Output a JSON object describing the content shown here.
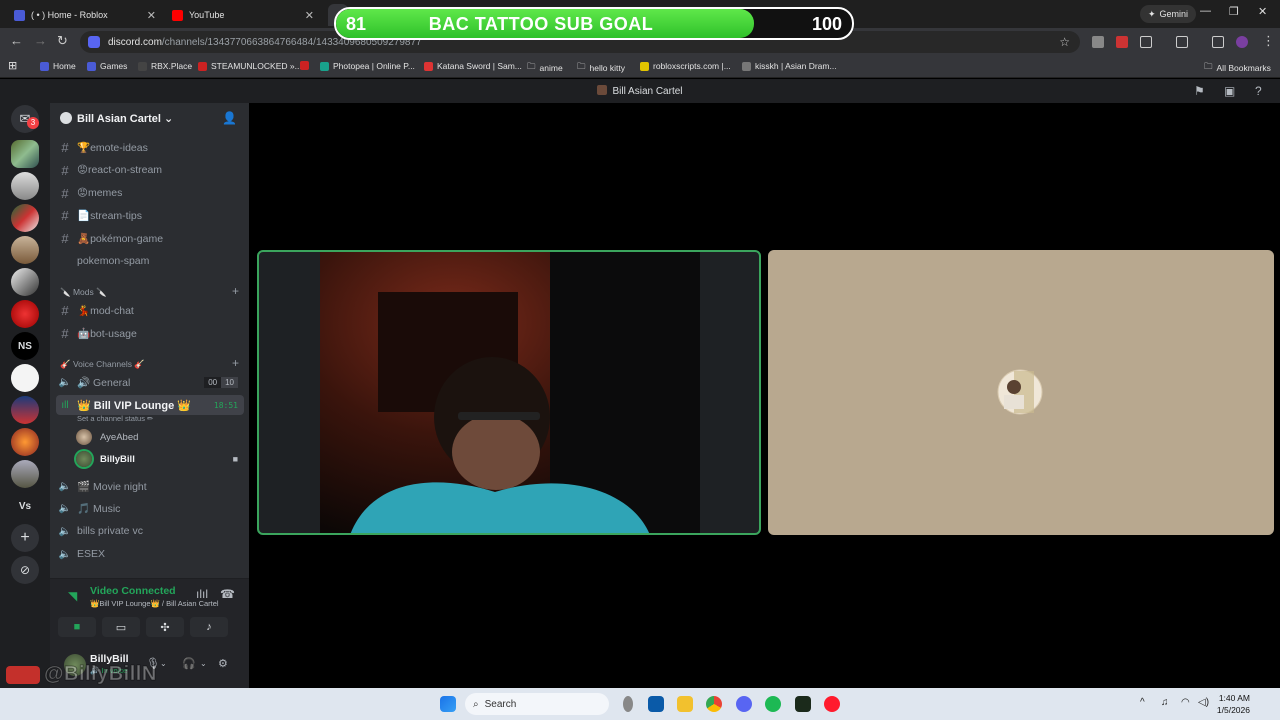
{
  "browser": {
    "tabs": [
      {
        "title": "( • ) Home - Roblox"
      },
      {
        "title": "YouTube"
      }
    ],
    "gemini_label": "Gemini",
    "url_host": "discord.com",
    "url_path": "/channels/1343770663864766484/1433409680509279877",
    "bookmarks": [
      "Home",
      "Games",
      "RBX.Place",
      "STEAMUNLOCKED »...",
      "Photopea | Online P...",
      "Katana Sword | Sam...",
      "anime",
      "hello kitty",
      "robloxscripts.com |...",
      "kisskh | Asian Dram..."
    ],
    "all_bookmarks": "All Bookmarks"
  },
  "overlay": {
    "goal_current": "81",
    "goal_title": "BAC TATTOO SUB GOAL",
    "goal_target": "100",
    "goal_progress": 0.81,
    "watermark": "@BillyBillN"
  },
  "discord": {
    "window_title": "Bill Asian Cartel",
    "server_name": "Bill Asian Cartel",
    "unread_badge": "3",
    "guilds_text": [
      "NS",
      "Vs"
    ],
    "text_channels": [
      {
        "emoji": "🏆",
        "name": "emote-ideas"
      },
      {
        "emoji": "😡",
        "name": "react-on-stream"
      },
      {
        "emoji": "😡",
        "name": "memes"
      },
      {
        "emoji": "📄",
        "name": "stream-tips"
      },
      {
        "emoji": "🧸",
        "name": "pokémon-game"
      },
      {
        "emoji": "",
        "name": "pokemon-spam"
      }
    ],
    "mods_category": "🔪 Mods 🔪",
    "mod_channels": [
      {
        "emoji": "💃",
        "name": "mod-chat"
      },
      {
        "emoji": "🤖",
        "name": "bot-usage"
      }
    ],
    "voice_category": "🎸 Voice Channels 🎸",
    "voice_channels": [
      {
        "name": "🔊 General",
        "count_a": "00",
        "count_b": "10"
      },
      {
        "name": "👑 Bill VIP Lounge 👑",
        "timer": "18:51",
        "status": "Set a channel status ✏"
      },
      {
        "name": "🎬 Movie night"
      },
      {
        "name": "🎵 Music"
      },
      {
        "name": "bills private vc"
      },
      {
        "name": "ESEX"
      }
    ],
    "members": [
      {
        "name": "AyeAbed"
      },
      {
        "name": "BillyBill"
      }
    ],
    "voice_panel": {
      "status": "Video Connected",
      "location": "👑Bill VIP Lounge👑 / Bill Asian Cartel"
    },
    "user": {
      "name": "BillyBill",
      "sub": "🔊 In voice"
    }
  },
  "taskbar": {
    "search_placeholder": "Search",
    "time": "1:40 AM",
    "date": "1/5/2026"
  },
  "colors": {
    "discord_green": "#23a55a",
    "goal_green": "#3fd33a",
    "blurple": "#5865f2"
  }
}
